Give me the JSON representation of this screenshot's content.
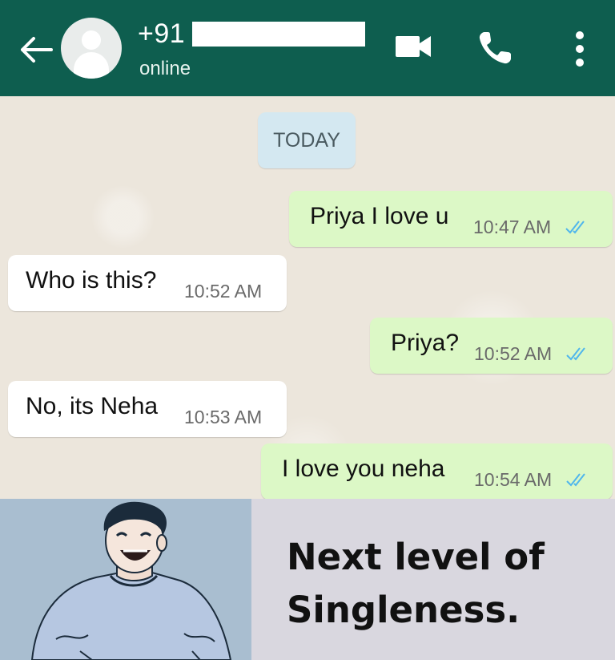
{
  "header": {
    "contact_name": "+91",
    "status": "online",
    "icons": {
      "back": "arrow-left-icon",
      "avatar": "default-avatar-icon",
      "video": "video-call-icon",
      "phone": "voice-call-icon",
      "menu": "more-vert-icon"
    },
    "colors": {
      "header_bg": "#0e5e4f"
    }
  },
  "chat": {
    "date_label": "TODAY",
    "messages": [
      {
        "direction": "out",
        "text": "Priya I love u",
        "time": "10:47 AM",
        "read": true
      },
      {
        "direction": "in",
        "text": "Who is this?",
        "time": "10:52 AM"
      },
      {
        "direction": "out",
        "text": "Priya?",
        "time": "10:52 AM",
        "read": true
      },
      {
        "direction": "in",
        "text": "No, its Neha",
        "time": "10:53 AM"
      },
      {
        "direction": "out",
        "text": "I love you neha",
        "time": "10:54 AM",
        "read": true
      }
    ],
    "colors": {
      "outgoing": "#dcf8c6",
      "incoming": "#ffffff",
      "read_ticks": "#4fb6ec"
    }
  },
  "meme": {
    "caption_line1": "Next level of",
    "caption_line2": "Singleness."
  }
}
